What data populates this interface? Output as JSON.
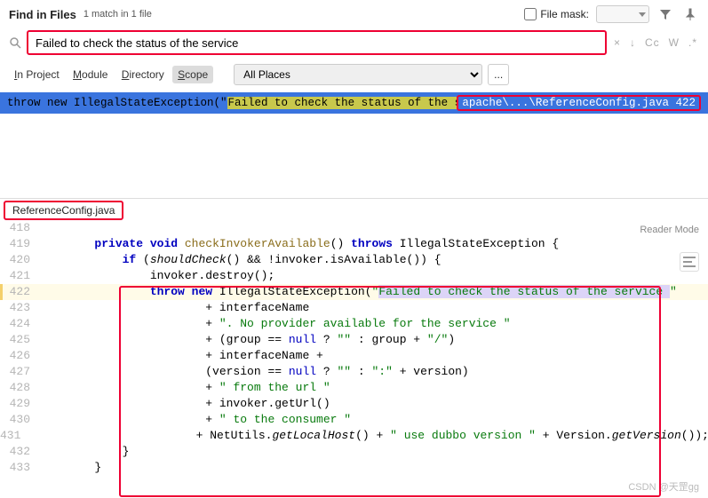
{
  "header": {
    "title": "Find in Files",
    "subtitle": "1 match in 1 file",
    "file_mask_label": "File mask:"
  },
  "search": {
    "query": "Failed to check the status of the service"
  },
  "scope": {
    "tabs": [
      "In Project",
      "Module",
      "Directory",
      "Scope"
    ],
    "active": 3,
    "places_selected": "All Places",
    "dots": "..."
  },
  "toolbar_icons": {
    "close": "×",
    "down": "↓",
    "cc": "Cc",
    "w": "W",
    "regex": ".*"
  },
  "result": {
    "prefix": "throw new IllegalStateException(\"",
    "match": "Failed to check the status of the service ",
    "suffix": "\"",
    "file_path": "apache\\...\\ReferenceConfig.java",
    "line_no": "422"
  },
  "file_tab": "ReferenceConfig.java",
  "editor": {
    "reader_mode": "Reader Mode",
    "lines": [
      {
        "n": "418",
        "text": ""
      },
      {
        "n": "419",
        "indent": "        ",
        "tokens": [
          {
            "t": "private",
            "c": "kw"
          },
          {
            "t": " "
          },
          {
            "t": "void",
            "c": "kw"
          },
          {
            "t": " "
          },
          {
            "t": "checkInvokerAvailable",
            "c": "mname"
          },
          {
            "t": "() "
          },
          {
            "t": "throws",
            "c": "kw"
          },
          {
            "t": " IllegalStateException {"
          }
        ]
      },
      {
        "n": "420",
        "indent": "            ",
        "tokens": [
          {
            "t": "if",
            "c": "kw"
          },
          {
            "t": " ("
          },
          {
            "t": "shouldCheck",
            "c": "fcall itc"
          },
          {
            "t": "() && !"
          },
          {
            "t": "invoker",
            "c": ""
          },
          {
            "t": ".isAvailable()) {"
          }
        ]
      },
      {
        "n": "421",
        "indent": "                ",
        "tokens": [
          {
            "t": "invoker"
          },
          {
            "t": ".destroy();"
          }
        ]
      },
      {
        "n": "422",
        "hl": true,
        "indent": "                ",
        "tokens": [
          {
            "t": "throw",
            "c": "kw"
          },
          {
            "t": " "
          },
          {
            "t": "new",
            "c": "kw"
          },
          {
            "t": " IllegalStateException("
          },
          {
            "t": "\"",
            "c": "str"
          },
          {
            "t": "Failed to check the status of the service ",
            "c": "str match-hl"
          },
          {
            "t": "\"",
            "c": "str"
          }
        ]
      },
      {
        "n": "423",
        "indent": "                        ",
        "tokens": [
          {
            "t": "+ interfaceName"
          }
        ]
      },
      {
        "n": "424",
        "indent": "                        ",
        "tokens": [
          {
            "t": "+ "
          },
          {
            "t": "\". No provider available for the service \"",
            "c": "str"
          }
        ]
      },
      {
        "n": "425",
        "indent": "                        ",
        "tokens": [
          {
            "t": "+ (group == "
          },
          {
            "t": "null",
            "c": "kw2"
          },
          {
            "t": " ? "
          },
          {
            "t": "\"\"",
            "c": "str"
          },
          {
            "t": " : group + "
          },
          {
            "t": "\"/\"",
            "c": "str"
          },
          {
            "t": ")"
          }
        ]
      },
      {
        "n": "426",
        "indent": "                        ",
        "tokens": [
          {
            "t": "+ interfaceName +"
          }
        ]
      },
      {
        "n": "427",
        "indent": "                        ",
        "tokens": [
          {
            "t": "(version == "
          },
          {
            "t": "null",
            "c": "kw2"
          },
          {
            "t": " ? "
          },
          {
            "t": "\"\"",
            "c": "str"
          },
          {
            "t": " : "
          },
          {
            "t": "\":\"",
            "c": "str"
          },
          {
            "t": " + version)"
          }
        ]
      },
      {
        "n": "428",
        "indent": "                        ",
        "tokens": [
          {
            "t": "+ "
          },
          {
            "t": "\" from the url \"",
            "c": "str"
          }
        ]
      },
      {
        "n": "429",
        "indent": "                        ",
        "tokens": [
          {
            "t": "+ "
          },
          {
            "t": "invoker"
          },
          {
            "t": ".getUrl()"
          }
        ]
      },
      {
        "n": "430",
        "indent": "                        ",
        "tokens": [
          {
            "t": "+ "
          },
          {
            "t": "\" to the consumer \"",
            "c": "str"
          }
        ]
      },
      {
        "n": "431",
        "indent": "                        ",
        "tokens": [
          {
            "t": "+ NetUtils."
          },
          {
            "t": "getLocalHost",
            "c": "itc"
          },
          {
            "t": "() + "
          },
          {
            "t": "\" use dubbo version \"",
            "c": "str"
          },
          {
            "t": " + Version."
          },
          {
            "t": "getVersion",
            "c": "itc"
          },
          {
            "t": "());"
          }
        ]
      },
      {
        "n": "432",
        "indent": "            ",
        "tokens": [
          {
            "t": "}"
          }
        ]
      },
      {
        "n": "433",
        "indent": "        ",
        "tokens": [
          {
            "t": "}"
          }
        ]
      }
    ]
  },
  "watermark": "CSDN @天罡gg"
}
